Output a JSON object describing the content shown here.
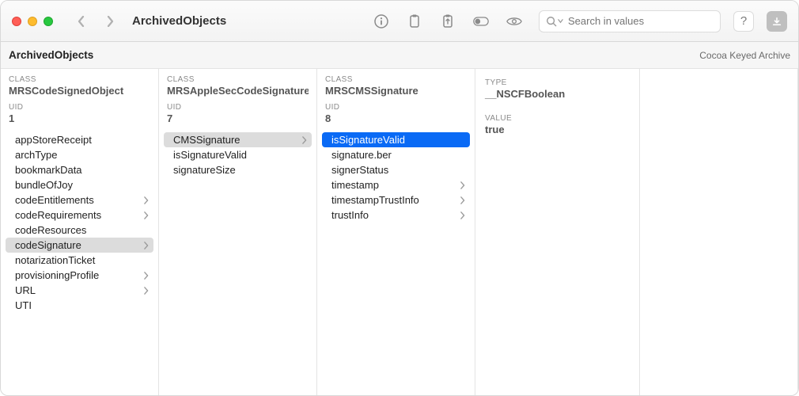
{
  "titlebar": {
    "title": "ArchivedObjects",
    "search_placeholder": "Search in values",
    "help_label": "?"
  },
  "subheader": {
    "breadcrumb": "ArchivedObjects",
    "format": "Cocoa Keyed Archive"
  },
  "columns": [
    {
      "header": {
        "class_label": "CLASS",
        "class_value": "MRSCodeSignedObject",
        "uid_label": "UID",
        "uid_value": "1"
      },
      "items": [
        {
          "label": "appStoreReceipt",
          "has_children": false
        },
        {
          "label": "archType",
          "has_children": false
        },
        {
          "label": "bookmarkData",
          "has_children": false
        },
        {
          "label": "bundleOfJoy",
          "has_children": false
        },
        {
          "label": "codeEntitlements",
          "has_children": true
        },
        {
          "label": "codeRequirements",
          "has_children": true
        },
        {
          "label": "codeResources",
          "has_children": false
        },
        {
          "label": "codeSignature",
          "has_children": true,
          "selected": "gray"
        },
        {
          "label": "notarizationTicket",
          "has_children": false
        },
        {
          "label": "provisioningProfile",
          "has_children": true
        },
        {
          "label": "URL",
          "has_children": true
        },
        {
          "label": "UTI",
          "has_children": false
        }
      ]
    },
    {
      "header": {
        "class_label": "CLASS",
        "class_value": "MRSAppleSecCodeSignature",
        "uid_label": "UID",
        "uid_value": "7"
      },
      "items": [
        {
          "label": "CMSSignature",
          "has_children": true,
          "selected": "gray"
        },
        {
          "label": "isSignatureValid",
          "has_children": false
        },
        {
          "label": "signatureSize",
          "has_children": false
        }
      ]
    },
    {
      "header": {
        "class_label": "CLASS",
        "class_value": "MRSCMSSignature",
        "uid_label": "UID",
        "uid_value": "8"
      },
      "items": [
        {
          "label": "isSignatureValid",
          "has_children": false,
          "selected": "blue"
        },
        {
          "label": "signature.ber",
          "has_children": false
        },
        {
          "label": "signerStatus",
          "has_children": false
        },
        {
          "label": "timestamp",
          "has_children": true
        },
        {
          "label": "timestampTrustInfo",
          "has_children": true
        },
        {
          "label": "trustInfo",
          "has_children": true
        }
      ]
    }
  ],
  "detail": {
    "type_label": "TYPE",
    "type_value": "__NSCFBoolean",
    "value_label": "VALUE",
    "value_value": "true"
  }
}
